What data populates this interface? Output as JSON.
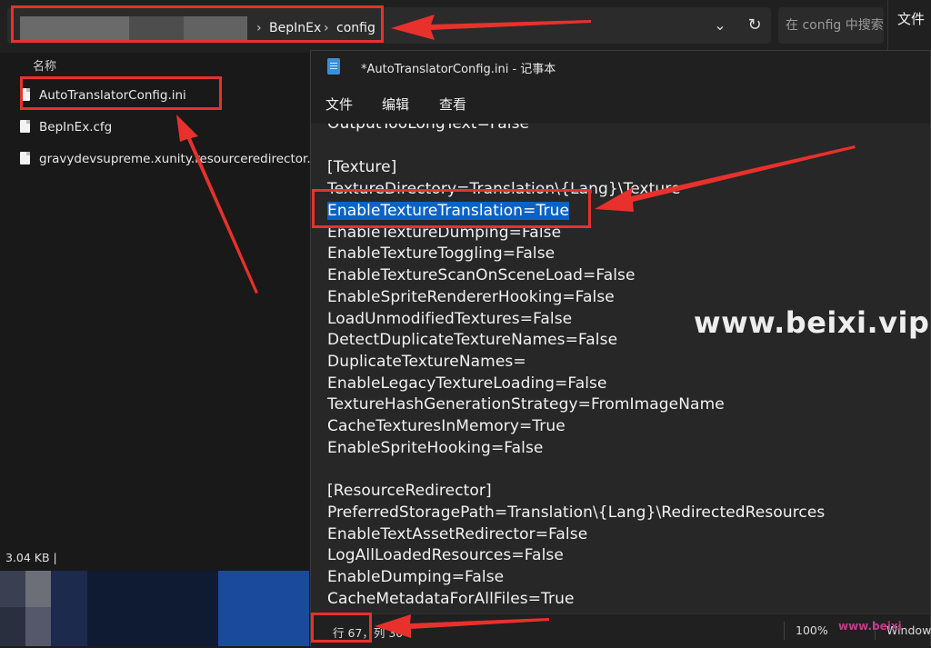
{
  "explorer": {
    "breadcrumb": [
      "BepInEx",
      "config"
    ],
    "search_placeholder": "在 config 中搜索",
    "right_menu": "文件",
    "column_header": "名称",
    "files": [
      "AutoTranslatorConfig.ini",
      "BepInEx.cfg",
      "gravydevsupreme.xunity.resourceredirector..."
    ],
    "status": "3.04 KB"
  },
  "notepad": {
    "title": "*AutoTranslatorConfig.ini - 记事本",
    "menu": [
      "文件",
      "编辑",
      "查看"
    ],
    "lines": [
      "OutputTooLongText=False",
      "",
      "[Texture]",
      "TextureDirectory=Translation\\{Lang}\\Texture",
      "EnableTextureTranslation=True",
      "EnableTextureDumping=False",
      "EnableTextureToggling=False",
      "EnableTextureScanOnSceneLoad=False",
      "EnableSpriteRendererHooking=False",
      "LoadUnmodifiedTextures=False",
      "DetectDuplicateTextureNames=False",
      "DuplicateTextureNames=",
      "EnableLegacyTextureLoading=False",
      "TextureHashGenerationStrategy=FromImageName",
      "CacheTexturesInMemory=True",
      "EnableSpriteHooking=False",
      "",
      "[ResourceRedirector]",
      "PreferredStoragePath=Translation\\{Lang}\\RedirectedResources",
      "EnableTextAssetRedirector=False",
      "LogAllLoadedResources=False",
      "EnableDumping=False",
      "CacheMetadataForAllFiles=True"
    ],
    "status": {
      "position": "行 67，列 30",
      "zoom": "100%",
      "line_ending": "Windows"
    }
  },
  "watermark": "www.beixi.vip",
  "watermark_small": "www.beixi",
  "colors": {
    "annotation": "#e8312c",
    "selection": "#0a63c4"
  }
}
